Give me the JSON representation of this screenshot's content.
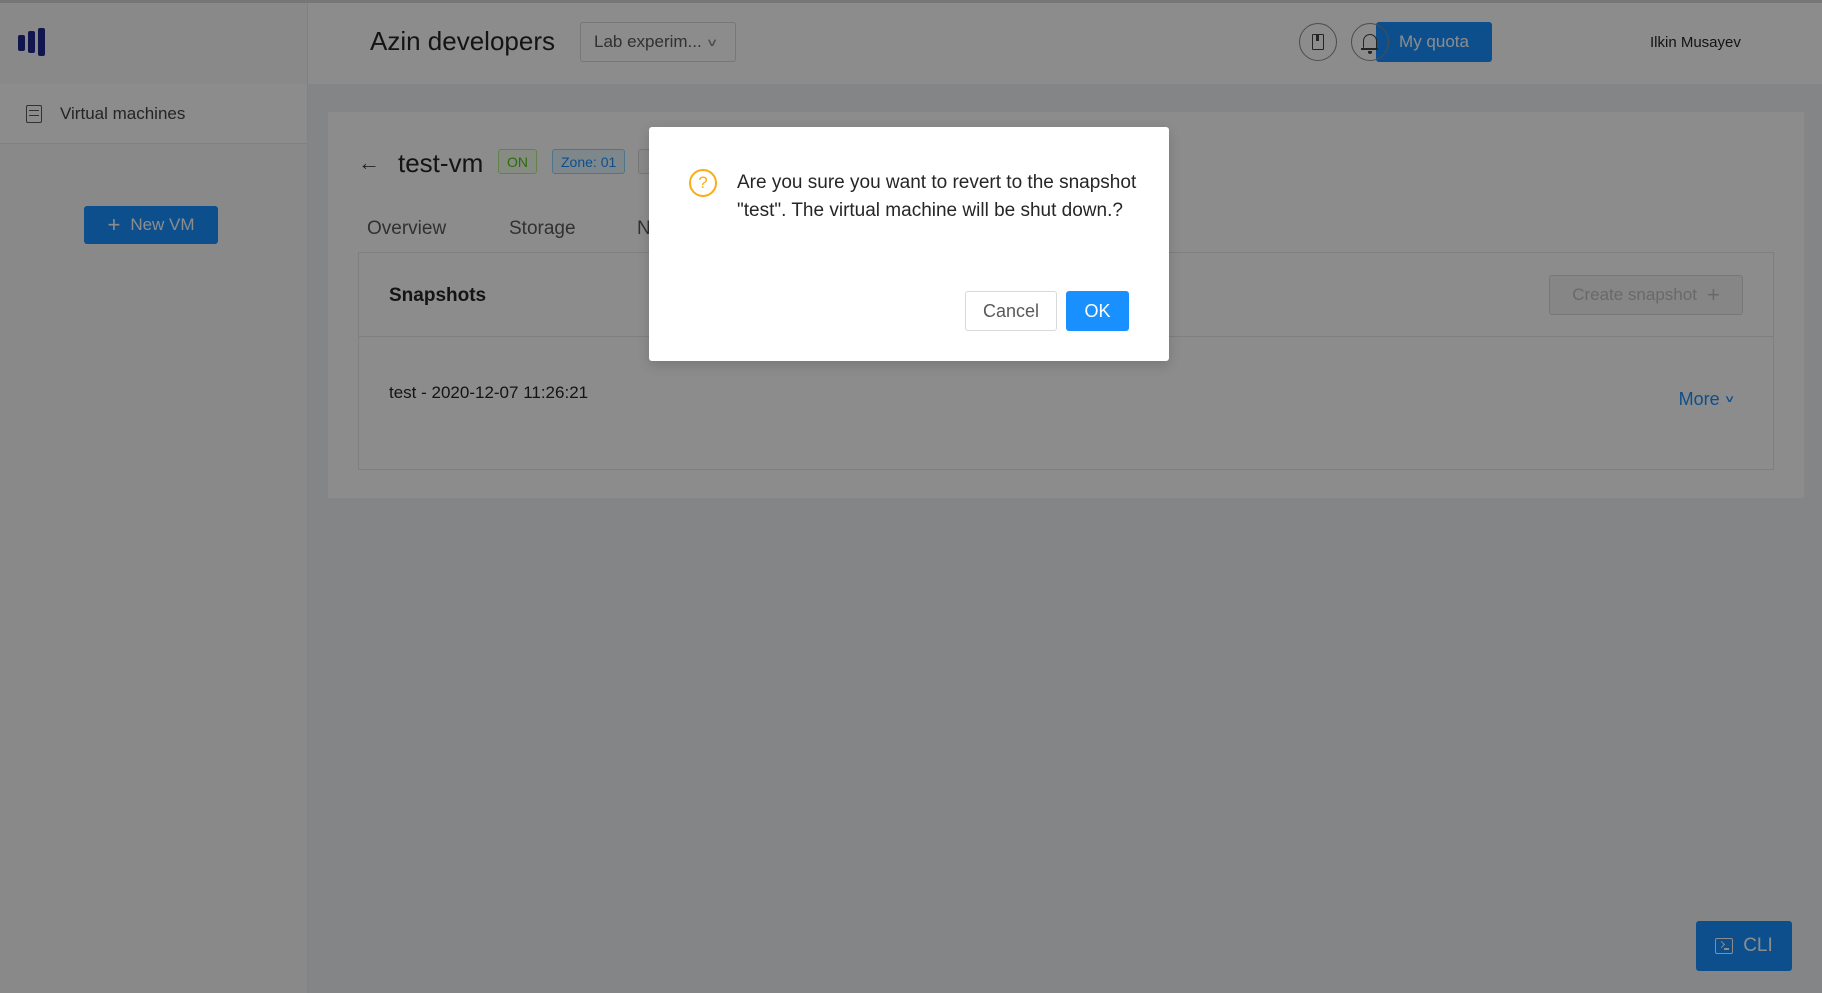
{
  "sidebar": {
    "logo": "logo-icon",
    "items": [
      {
        "label": "Virtual machines",
        "icon": "server-icon"
      }
    ],
    "new_vm_label": "New VM"
  },
  "header": {
    "org_name": "Azin developers",
    "project_select": "Lab experim...",
    "quota_label": "My quota",
    "docs_icon": "book-icon",
    "notifications_icon": "bell-icon",
    "user_name": "Ilkin Musayev"
  },
  "vm": {
    "name": "test-vm",
    "status": "ON",
    "zone": "Zone: 01",
    "tabs": [
      "Overview",
      "Storage",
      "N"
    ]
  },
  "snapshots": {
    "title": "Snapshots",
    "create_label": "Create snapshot",
    "rows": [
      {
        "label": "test - 2020-12-07 11:26:21",
        "more_label": "More"
      }
    ]
  },
  "cli_label": "CLI",
  "modal": {
    "message": "Are you sure you want to revert to the snapshot \"test\". The virtual machine will be shut down.?",
    "cancel_label": "Cancel",
    "ok_label": "OK"
  },
  "colors": {
    "primary": "#1890ff",
    "warning": "#faad14",
    "success": "#52c41a",
    "logo": "#1f2b8f"
  }
}
